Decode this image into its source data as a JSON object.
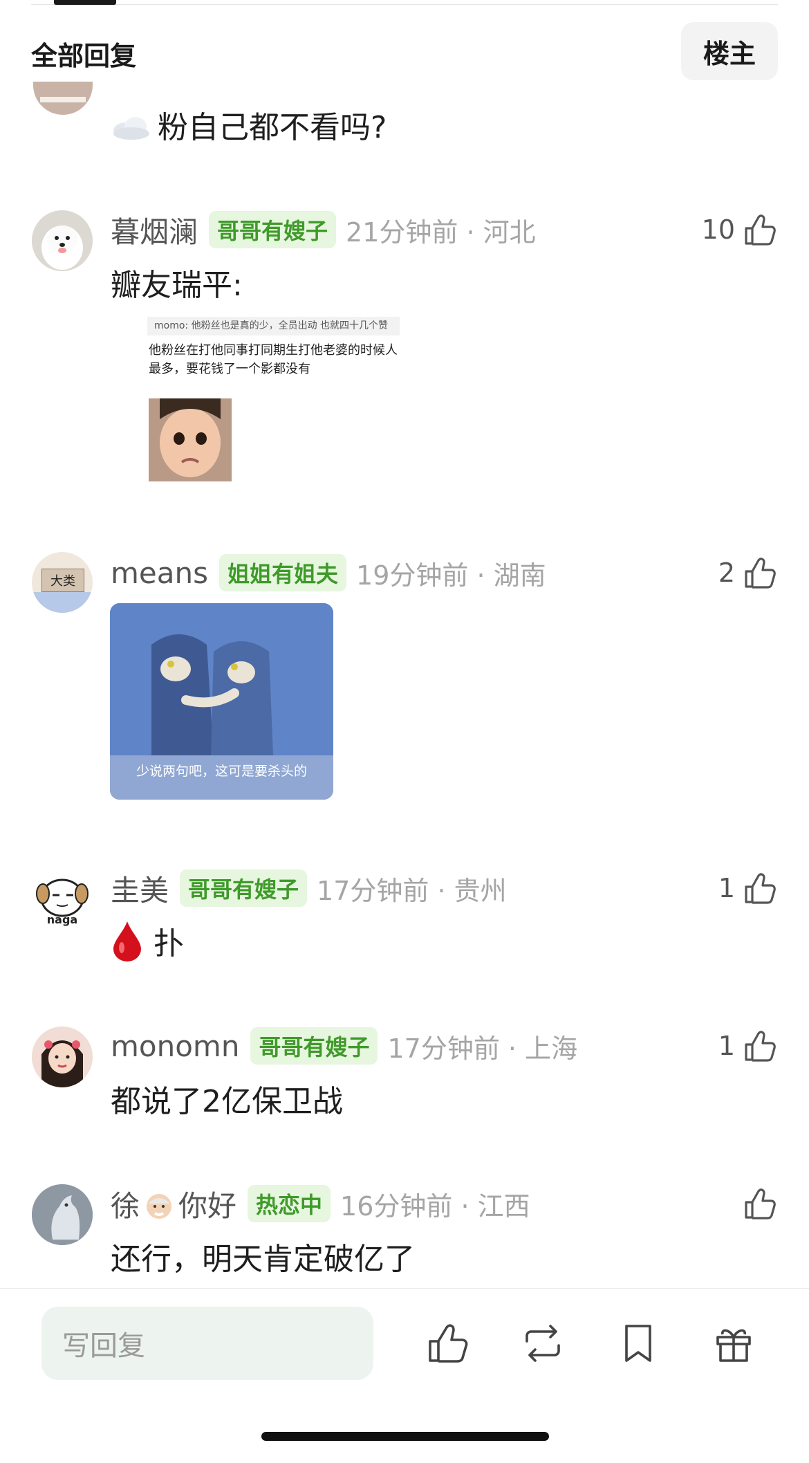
{
  "header": {
    "title": "全部回复",
    "owner_button": "楼主"
  },
  "previous_comment": {
    "text": "粉自己都不看吗?",
    "emoji_icon": "cloud-emoji"
  },
  "comments": [
    {
      "name": "暮烟澜",
      "badge": "哥哥有嫂子",
      "meta": "21分钟前 · 河北",
      "likes": "10",
      "text": "瓣友瑞平:",
      "attachment": {
        "quote": "momo: 他粉丝也是真的少，全员出动 也就四十几个赞",
        "caption": "他粉丝在打他同事打同期生打他老婆的时候人最多，要花钱了一个影都没有"
      }
    },
    {
      "name": "means",
      "badge": "姐姐有姐夫",
      "meta": "19分钟前 · 湖南",
      "likes": "2",
      "avatar_text": "大类",
      "image_caption": "少说两句吧，这可是要杀头的"
    },
    {
      "name": "圭美",
      "badge": "哥哥有嫂子",
      "meta": "17分钟前 · 贵州",
      "likes": "1",
      "text": "扑",
      "avatar_text": "naga"
    },
    {
      "name": "monomn",
      "badge": "哥哥有嫂子",
      "meta": "17分钟前 · 上海",
      "likes": "1",
      "text": "都说了2亿保卫战"
    },
    {
      "name_part1": "徐",
      "name_part2": "你好",
      "badge": "热恋中",
      "meta": "16分钟前 · 江西",
      "likes": "",
      "text": "还行，明天肯定破亿了"
    }
  ],
  "bottom_bar": {
    "reply_placeholder": "写回复"
  },
  "colors": {
    "badge_bg": "#e6f6df",
    "badge_text": "#3f9a2a",
    "input_bg": "#edf3ee"
  }
}
